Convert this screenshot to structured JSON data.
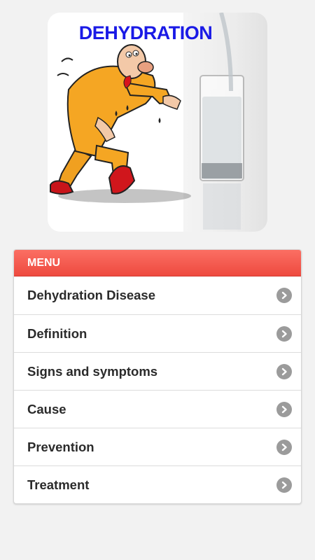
{
  "banner": {
    "title": "DEHYDRATION",
    "image_subject": "Cartoon man staggering toward a glass of water"
  },
  "menu": {
    "header": "MENU",
    "items": [
      {
        "label": "Dehydration Disease",
        "icon": "chevron-right-icon"
      },
      {
        "label": "Definition",
        "icon": "chevron-right-icon"
      },
      {
        "label": "Signs and symptoms",
        "icon": "chevron-right-icon"
      },
      {
        "label": "Cause",
        "icon": "chevron-right-icon"
      },
      {
        "label": "Prevention",
        "icon": "chevron-right-icon"
      },
      {
        "label": "Treatment",
        "icon": "chevron-right-icon"
      }
    ]
  },
  "colors": {
    "background": "#f2f2f2",
    "header_red": "#ee4a3f",
    "title_blue": "#1a1ae6",
    "text_dark": "#2b2b2b",
    "chevron_grey": "#9b9b9b"
  }
}
